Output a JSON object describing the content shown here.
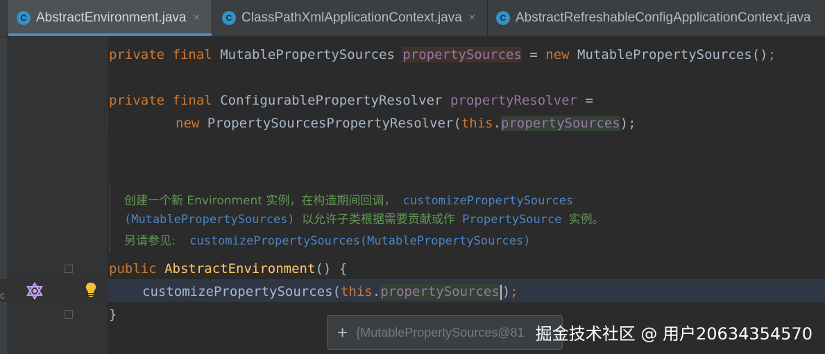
{
  "tabs": [
    {
      "label": "AbstractEnvironment.java",
      "icon": "class-icon",
      "icon_letter": "C",
      "active": true,
      "close": "×"
    },
    {
      "label": "ClassPathXmlApplicationContext.java",
      "icon": "class-icon",
      "icon_letter": "C",
      "active": false,
      "close": "×"
    },
    {
      "label": "AbstractRefreshableConfigApplicationContext.java",
      "icon": "class-icon",
      "icon_letter": "C",
      "active": false
    }
  ],
  "code": {
    "line1": {
      "kw1": "private",
      "kw2": "final",
      "type": "MutablePropertySources",
      "field": "propertySources",
      "eq": "=",
      "kw3": "new",
      "ctor": "MutablePropertySources()",
      "semi": ";"
    },
    "line2": {
      "kw1": "private",
      "kw2": "final",
      "type": "ConfigurablePropertyResolver",
      "field": "propertyResolver",
      "eq": "="
    },
    "line3": {
      "kw": "new",
      "ctor": "PropertySourcesPropertyResolver(",
      "this": "this",
      "dot": ".",
      "field": "propertySources",
      "close": ");"
    },
    "doc": {
      "l1_text": "创建一个新 Environment 实例，在构造期间回调，",
      "l1_code": "customizePropertySources",
      "l2_code": "(MutablePropertySources)",
      "l2_text": "以允许子类根据需要贡献或作",
      "l2_code2": "PropertySource",
      "l2_text2": "实例。",
      "l3_text": "另请参见:",
      "l3_code": "customizePropertySources(MutablePropertySources)"
    },
    "line4": {
      "kw": "public",
      "name": "AbstractEnvironment",
      "rest": "() {"
    },
    "line5": {
      "call": "customizePropertySources(",
      "this": "this",
      "dot": ".",
      "field": "propertySource",
      "field_end": "s",
      "close": ")",
      "semi": ";"
    },
    "line6": {
      "brace": "}"
    }
  },
  "gutter": {
    "left_text": "c"
  },
  "tooltip": {
    "plus": "+",
    "text": "{MutablePropertySources@81"
  },
  "watermark": "掘金技术社区 @ 用户20634354570",
  "colors": {
    "keyword": "#cc7832",
    "field": "#9876aa",
    "doc": "#629755",
    "doc_code": "#4a86c7",
    "accent": "#4a88c7"
  }
}
